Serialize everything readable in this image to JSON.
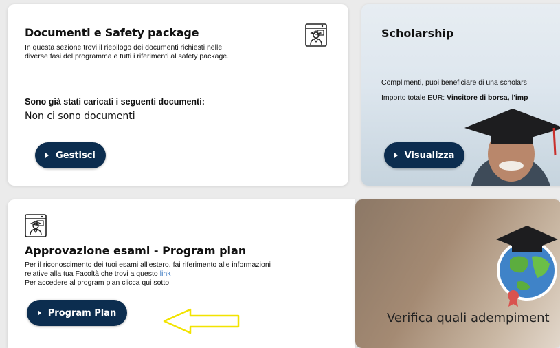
{
  "documents_card": {
    "title": "Documenti e Safety package",
    "description": "In questa sezione trovi il riepilogo dei documenti richiesti nelle diverse fasi del programma e tutti i riferimenti al safety package.",
    "subheading": "Sono già stati caricati i seguenti documenti:",
    "empty_state": "Non ci sono documenti",
    "button_label": "Gestisci",
    "icon": "student-certificate-icon"
  },
  "scholarship_card": {
    "title": "Scholarship",
    "line1": "Complimenti, puoi beneficiare di una scholars",
    "line2_prefix": "Importo totale EUR: ",
    "line2_bold": "Vincitore di borsa, l'imp",
    "button_label": "Visualizza"
  },
  "program_plan_card": {
    "title": "Approvazione esami - Program plan",
    "description_line1": "Per il riconoscimento dei tuoi esami all'estero, fai riferimento alle informazioni",
    "description_line2_prefix": "relative alla tua Facoltà che trovi a questo ",
    "link_text": "link",
    "description_line3": "Per accedere al program plan clicca qui sotto",
    "button_label": "Program Plan",
    "icon": "student-certificate-icon",
    "annotation": "yellow-arrow-pointing-left"
  },
  "verify_card": {
    "text": "Verifica quali adempiment"
  },
  "colors": {
    "button_bg": "#0c2d4f",
    "link": "#1a63b8",
    "arrow": "#f2e300"
  }
}
